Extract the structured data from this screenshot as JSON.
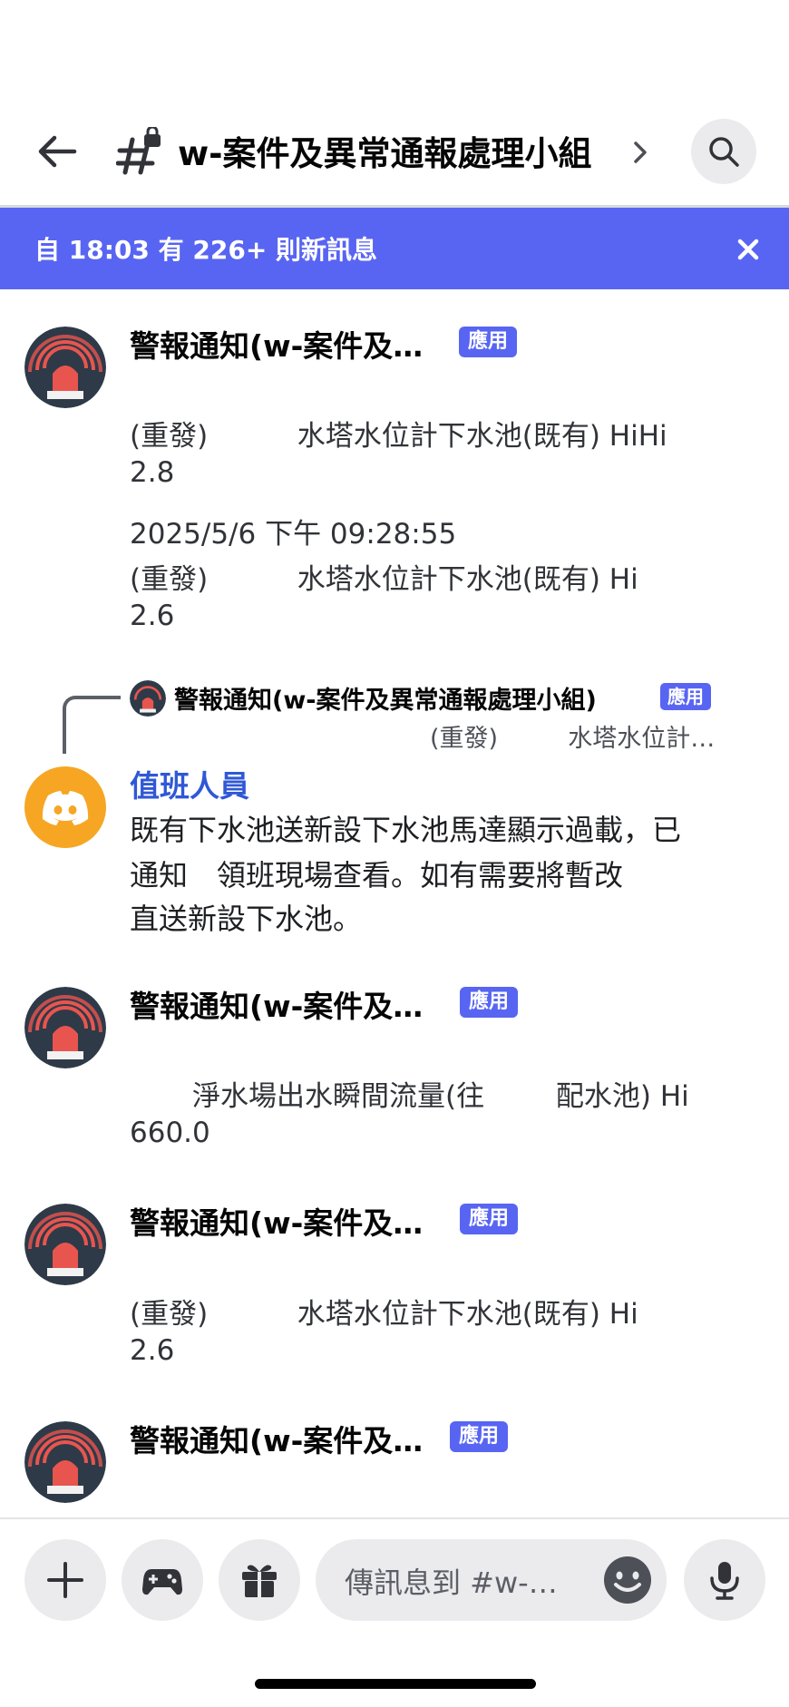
{
  "header": {
    "channel_title": "w-案件及異常通報處理小組"
  },
  "banner": {
    "text": "自 18:03 有 226+ 則新訊息"
  },
  "messages": [
    {
      "author": "警報通知(w-案件及…",
      "tag": "應用",
      "lines": [
        "(重發)          水塔水位計下水池(既有) HiHi",
        "2.8",
        "2025/5/6 下午 09:28:55",
        "(重發)          水塔水位計下水池(既有) Hi",
        "2.6"
      ]
    },
    {
      "reply": {
        "author": "警報通知(w-案件及異常通報處理小組)",
        "tag": "應用",
        "preview": "(重發)         水塔水位計…"
      },
      "author": "值班人員",
      "lines": [
        "既有下水池送新設下水池馬達顯示過載，已",
        "通知　領班現場查看。如有需要將暫改",
        "直送新設下水池。"
      ]
    },
    {
      "author": "警報通知(w-案件及…",
      "tag": "應用",
      "lines": [
        "       淨水場出水瞬間流量(往        配水池) Hi",
        "660.0"
      ]
    },
    {
      "author": "警報通知(w-案件及…",
      "tag": "應用",
      "lines": [
        "(重發)          水塔水位計下水池(既有) Hi",
        "2.6"
      ]
    },
    {
      "author": "警報通知(w-案件及…",
      "tag": "應用",
      "lines": []
    }
  ],
  "composer": {
    "placeholder": "傳訊息到 #w-…"
  },
  "icons": {
    "back": "arrow-left-icon",
    "channel": "locked-hashtag-icon",
    "search": "search-icon",
    "close": "close-icon",
    "alarm_avatar": "alarm-siren-icon",
    "discord_avatar": "discord-logo-icon",
    "plus": "plus-icon",
    "game": "gamepad-icon",
    "gift": "gift-icon",
    "emoji": "emoji-icon",
    "mic": "microphone-icon"
  },
  "colors": {
    "accent": "#5865f2",
    "link_author": "#2f58d6",
    "discord_avatar_bg": "#f6a623",
    "alarm_avatar_bg": "#2e3a48"
  }
}
